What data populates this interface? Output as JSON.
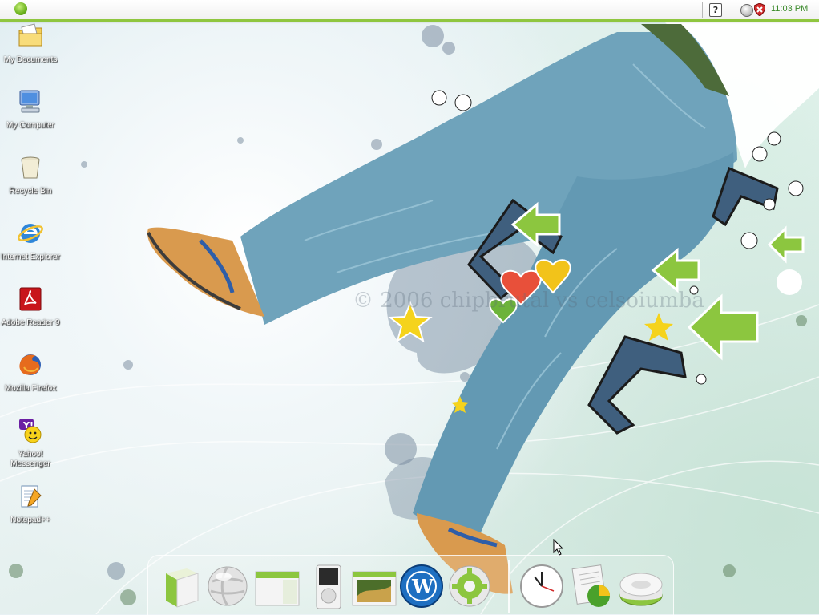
{
  "top_bar": {
    "start_button": "start-orb",
    "tray_icons": [
      "help-icon",
      "volume-icon",
      "security-shield-icon"
    ],
    "clock": "11:03 PM"
  },
  "wallpaper": {
    "watermark": "© 2006 chipbrutal vs celsoiumba"
  },
  "desktop_icons": [
    {
      "label": "My Documents",
      "icon": "folder-icon"
    },
    {
      "label": "My Computer",
      "icon": "computer-icon"
    },
    {
      "label": "Recycle Bin",
      "icon": "recycle-bin-icon"
    },
    {
      "label": "Internet Explorer",
      "icon": "internet-explorer-icon"
    },
    {
      "label": "Adobe Reader 9",
      "icon": "adobe-reader-icon"
    },
    {
      "label": "Mozilla Firefox",
      "icon": "firefox-icon"
    },
    {
      "label": "Yahoo! Messenger",
      "icon": "yahoo-messenger-icon"
    },
    {
      "label": "Notepad++",
      "icon": "notepad-icon"
    }
  ],
  "dock": {
    "items": [
      "box-icon",
      "globe-icon",
      "window-icon",
      "ipod-icon",
      "photo-icon",
      "wordpress-icon",
      "settings-gear-icon",
      "clock-icon",
      "chart-document-icon",
      "drive-icon"
    ]
  },
  "colors": {
    "accent_green": "#8fc63f",
    "jeans_blue": "#6fa3bb",
    "clock_text": "#3a8a2a"
  }
}
